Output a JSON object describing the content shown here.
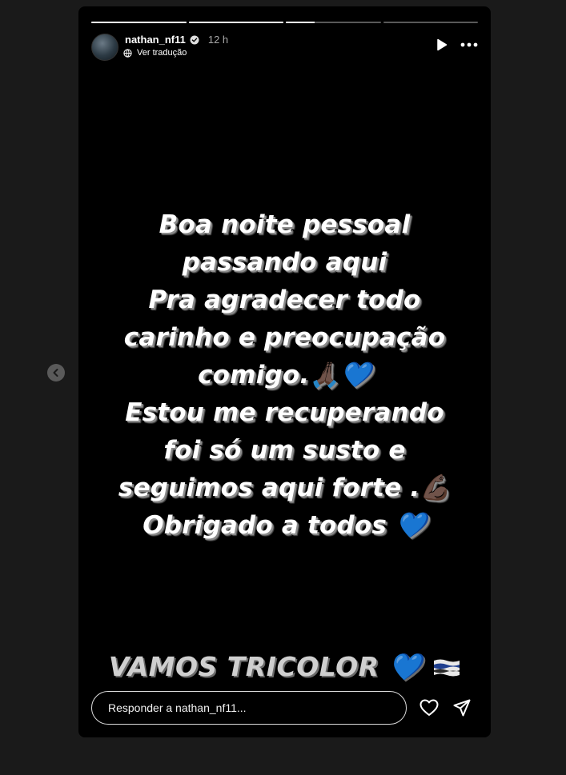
{
  "story": {
    "user": {
      "username": "nathan_nf11",
      "verified": true,
      "time_ago": "12 h"
    },
    "translate_label": "Ver tradução",
    "progress": [
      1.0,
      1.0,
      0.3,
      0.0
    ],
    "lines": [
      "Boa noite pessoal",
      "passando aqui",
      "Pra agradecer todo",
      "carinho e preocupação",
      "comigo.🙏🏿💙",
      "Estou me recuperando",
      "foi só um susto e",
      "seguimos aqui forte .💪🏿",
      "Obrigado a todos 💙"
    ],
    "caption": "VAMOS TRICOLOR 💙"
  },
  "reply": {
    "placeholder": "Responder a nathan_nf11..."
  },
  "icons": {
    "prev": "chevron-left-icon",
    "play": "play-icon",
    "more": "more-icon",
    "like": "heart-icon",
    "share": "send-icon",
    "translate": "translate-icon",
    "verified": "verified-badge-icon"
  },
  "colors": {
    "background": "#1a1a1a",
    "story_bg": "#000000",
    "text": "#ffffff",
    "muted": "#a8a8a8"
  }
}
